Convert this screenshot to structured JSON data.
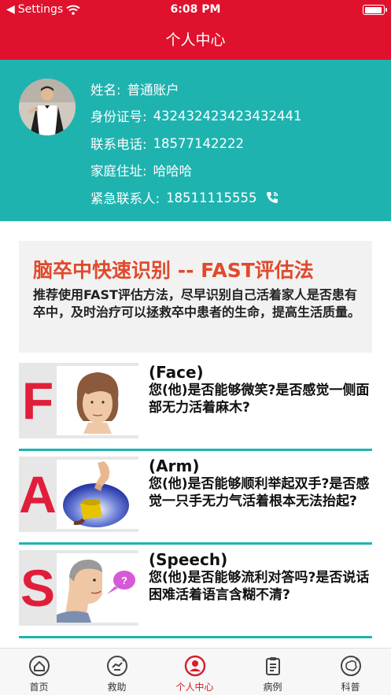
{
  "status_bar": {
    "back_label": "Settings",
    "time": "6:08 PM"
  },
  "nav": {
    "title": "个人中心"
  },
  "profile": {
    "rows": [
      {
        "label": "姓名:",
        "value": "普通账户"
      },
      {
        "label": "身份证号:",
        "value": "432432423423432441"
      },
      {
        "label": "联系电话:",
        "value": "18577142222"
      },
      {
        "label": "家庭住址:",
        "value": "哈哈哈"
      },
      {
        "label": "紧急联系人:",
        "value": "18511115555"
      }
    ]
  },
  "banner": {
    "title": "脑卒中快速识别 -- FAST评估法",
    "body": "推荐使用FAST评估方法，尽早识别自己活着家人是否患有卒中，及时治疗可以拯救卒中患者的生命，提高生活质量。"
  },
  "fast_items": [
    {
      "letter": "F",
      "heading": "(Face)",
      "text": "您(他)是否能够微笑?是否感觉一侧面部无力活着麻木?"
    },
    {
      "letter": "A",
      "heading": "(Arm)",
      "text": "您(他)是否能够顺利举起双手?是否感觉一只手无力气活着根本无法抬起?"
    },
    {
      "letter": "S",
      "heading": "(Speech)",
      "text": "您(他)是否能够流利对答吗?是否说话困难活着语言含糊不清?"
    }
  ],
  "tabs": [
    {
      "label": "首页",
      "icon": "home-icon",
      "active": false
    },
    {
      "label": "救助",
      "icon": "rescue-icon",
      "active": false
    },
    {
      "label": "个人中心",
      "icon": "profile-icon",
      "active": true
    },
    {
      "label": "病例",
      "icon": "clipboard-icon",
      "active": false
    },
    {
      "label": "科普",
      "icon": "brain-icon",
      "active": false
    }
  ],
  "colors": {
    "brand_red": "#e0112d",
    "teal": "#1fb3b0",
    "title_orange": "#e04a2c",
    "letter_red": "#e01e3a"
  }
}
